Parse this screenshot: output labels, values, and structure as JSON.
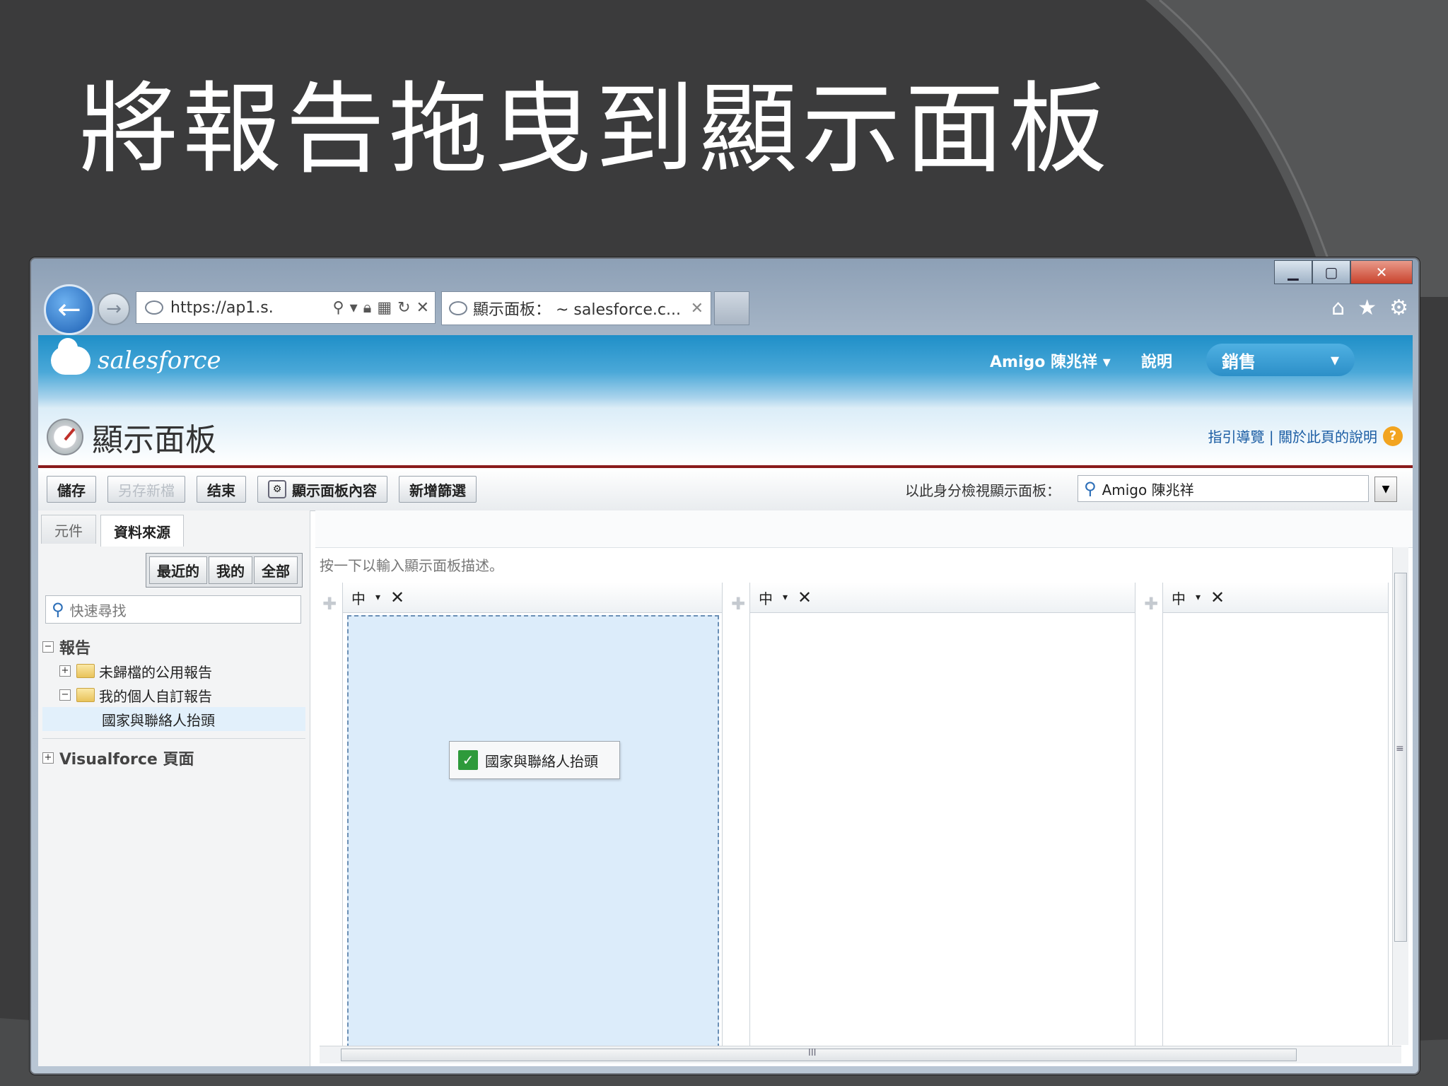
{
  "slide": {
    "title": "將報告拖曳到顯示面板"
  },
  "browser": {
    "address": "https://ap1.s.",
    "tab_title": "顯示面板： ~ salesforce.c...",
    "window_controls": [
      "minimize-icon",
      "maximize-icon",
      "close-icon"
    ],
    "toolbar_icons": [
      "home-icon",
      "star-icon",
      "gear-icon"
    ]
  },
  "header": {
    "logo": "salesforce",
    "user": "Amigo 陳兆祥",
    "help": "說明",
    "app": "銷售"
  },
  "titlebar": {
    "title": "顯示面板",
    "help_links": "指引導覽 | 關於此頁的說明"
  },
  "toolbar": {
    "save": "儲存",
    "save_as": "另存新檔",
    "close": "结束",
    "properties": "顯示面板內容",
    "add_filter": "新增篩選",
    "view_as_label": "以此身分檢視顯示面板：",
    "view_as_value": "Amigo 陳兆祥"
  },
  "left": {
    "tabs": [
      "元件",
      "資料來源"
    ],
    "active_tab": "資料來源",
    "filters": [
      "最近的",
      "我的",
      "全部"
    ],
    "search_placeholder": "快速尋找",
    "tree": {
      "reports": "報告",
      "unfiled": "未歸檔的公用報告",
      "personal": "我的個人自訂報告",
      "report_item": "國家與聯絡人抬頭",
      "visualforce": "Visualforce 頁面"
    }
  },
  "canvas": {
    "description_prompt": "按一下以輸入顯示面板描述。",
    "columns": [
      {
        "size": "中"
      },
      {
        "size": "中"
      },
      {
        "size": "中"
      }
    ],
    "dragged_item": "國家與聯絡人抬頭",
    "hscroll_grip": "III",
    "vscroll_grip": "≡"
  },
  "colors": {
    "header": "#1f8fc8",
    "accent_rule": "#8a1c1c",
    "drop_zone": "#dcecfa"
  }
}
